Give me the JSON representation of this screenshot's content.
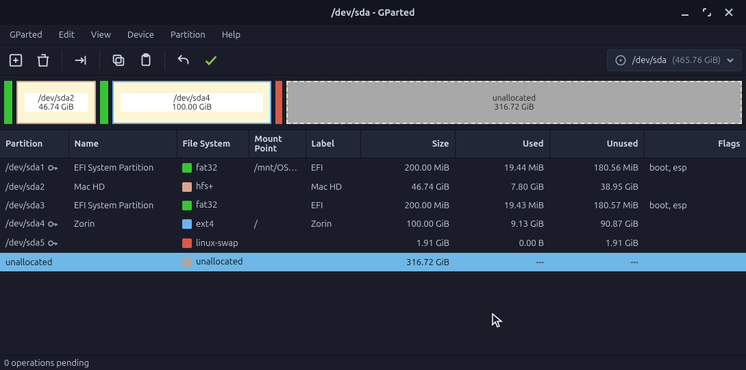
{
  "window": {
    "title": "/dev/sda - GParted"
  },
  "menu": [
    "GParted",
    "Edit",
    "View",
    "Device",
    "Partition",
    "Help"
  ],
  "disk_selector": {
    "path": "/dev/sda",
    "size": "(465.76 GiB)"
  },
  "visual": {
    "sda2": {
      "label": "/dev/sda2",
      "size": "46.74 GiB"
    },
    "sda4": {
      "label": "/dev/sda4",
      "size": "100.00 GiB"
    },
    "unallocated": {
      "label": "unallocated",
      "size": "316.72 GiB"
    }
  },
  "columns": {
    "partition": "Partition",
    "name": "Name",
    "filesystem": "File System",
    "mountpoint": "Mount Point",
    "label": "Label",
    "size": "Size",
    "used": "Used",
    "unused": "Unused",
    "flags": "Flags"
  },
  "rows": [
    {
      "partition": "/dev/sda1",
      "key": true,
      "name": "EFI System Partition",
      "fs": "fat32",
      "fscolor": "#39c235",
      "mount": "/mnt/OSX...",
      "label": "EFI",
      "size": "200.00 MiB",
      "used": "19.44 MiB",
      "unused": "180.56 MiB",
      "flags": "boot, esp",
      "selected": false
    },
    {
      "partition": "/dev/sda2",
      "key": false,
      "name": "Mac HD",
      "fs": "hfs+",
      "fscolor": "#d9a68e",
      "mount": "",
      "label": "Mac HD",
      "size": "46.74 GiB",
      "used": "7.80 GiB",
      "unused": "38.95 GiB",
      "flags": "",
      "selected": false
    },
    {
      "partition": "/dev/sda3",
      "key": false,
      "name": "EFI System Partition",
      "fs": "fat32",
      "fscolor": "#39c235",
      "mount": "",
      "label": "EFI",
      "size": "200.00 MiB",
      "used": "19.43 MiB",
      "unused": "180.57 MiB",
      "flags": "boot, esp",
      "selected": false
    },
    {
      "partition": "/dev/sda4",
      "key": true,
      "name": "Zorin",
      "fs": "ext4",
      "fscolor": "#6fb3f0",
      "mount": "/",
      "label": "Zorin",
      "size": "100.00 GiB",
      "used": "9.13 GiB",
      "unused": "90.87 GiB",
      "flags": "",
      "selected": false
    },
    {
      "partition": "/dev/sda5",
      "key": true,
      "name": "",
      "fs": "linux-swap",
      "fscolor": "#d65a46",
      "mount": "",
      "label": "",
      "size": "1.91 GiB",
      "used": "0.00 B",
      "unused": "1.91 GiB",
      "flags": "",
      "selected": false
    },
    {
      "partition": "unallocated",
      "key": false,
      "name": "",
      "fs": "unallocated",
      "fscolor": "#a8a8a8",
      "mount": "",
      "label": "",
      "size": "316.72 GiB",
      "used": "---",
      "unused": "---",
      "flags": "",
      "selected": true
    }
  ],
  "status": "0 operations pending"
}
